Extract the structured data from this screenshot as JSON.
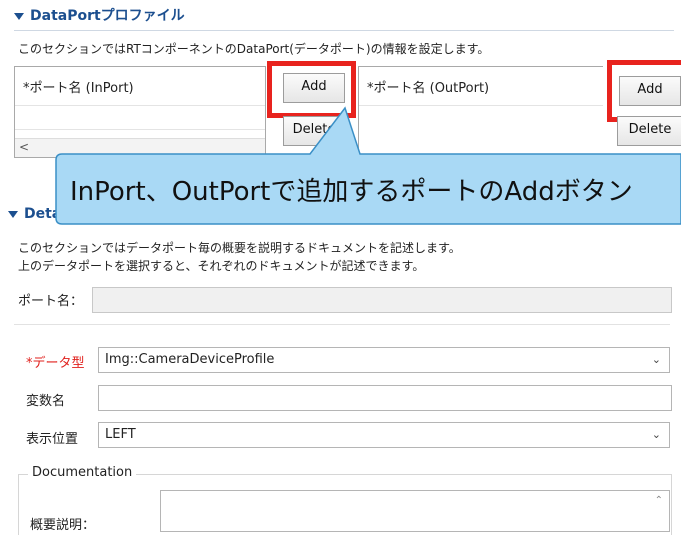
{
  "dataport_section": {
    "title": "DataPortプロファイル",
    "description": "このセクションではRTコンポーネントのDataPort(データポート)の情報を設定します。",
    "inport": {
      "column_header": "*ポート名 (InPort)",
      "add_label": "Add",
      "delete_label": "Delete"
    },
    "outport": {
      "column_header": "*ポート名 (OutPort)",
      "add_label": "Add",
      "delete_label": "Delete"
    }
  },
  "callout": {
    "text": "InPort、OutPortで追加するポートのAddボタン"
  },
  "detail_section": {
    "title": "Deta",
    "description_line1": "このセクションではデータポート毎の概要を説明するドキュメントを記述します。",
    "description_line2": "上のデータポートを選択すると、それぞれのドキュメントが記述できます。",
    "port_name_label": "ポート名：",
    "port_name_value": "",
    "datatype_label": "*データ型",
    "datatype_value": "Img::CameraDeviceProfile",
    "varname_label": "変数名",
    "varname_value": "",
    "position_label": "表示位置",
    "position_value": "LEFT",
    "documentation_group": "Documentation",
    "summary_label": "概要説明："
  },
  "colors": {
    "header_blue": "#1c4f8f",
    "highlight_red": "#e8231e",
    "callout_fill": "#a9d9f5",
    "required_red": "#e0201c"
  }
}
